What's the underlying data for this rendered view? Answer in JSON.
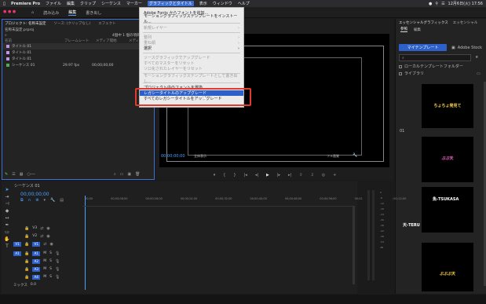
{
  "menubar": {
    "apple": "",
    "items": [
      "Premiere Pro",
      "ファイル",
      "編集",
      "クリップ",
      "シーケンス",
      "マーカー",
      "グラフィックとタイトル",
      "表示",
      "ウィンドウ",
      "ヘルプ"
    ],
    "selected_index": 6,
    "clock": "12月6日(火) 17:56"
  },
  "appbar": {
    "tabs": [
      "読み込み",
      "編集",
      "書き出し"
    ],
    "active_tab": "編集"
  },
  "project": {
    "tabs": [
      "プロジェクト: 名称未設定",
      "ソース: (クリップなし)",
      "エフェクト",
      "エフェクト"
    ],
    "file": "名称未設定.prproj",
    "info": "4個中 1 個の項目が選択",
    "columns": [
      "名前",
      "フレームレート",
      "メディア開始",
      "メディア終了"
    ],
    "rows": [
      {
        "name": "タイトル 01",
        "color": "#c792ea",
        "fps": "",
        "start": "",
        "end": ""
      },
      {
        "name": "タイトル 01",
        "color": "#c792ea",
        "fps": "",
        "start": "",
        "end": ""
      },
      {
        "name": "タイトル 01",
        "color": "#c792ea",
        "fps": "",
        "start": "",
        "end": ""
      },
      {
        "name": "シーケンス 01",
        "color": "#4caf50",
        "fps": "29.97 fps",
        "start": "00;00;00;00",
        "end": ""
      }
    ]
  },
  "menu": {
    "items": [
      {
        "label": "Adobe Fonts からフォントを追加...",
        "type": "item"
      },
      {
        "label": "モーショングラフィックステンプレートをインストール...",
        "type": "item"
      },
      {
        "type": "sep"
      },
      {
        "label": "新規レイヤー",
        "type": "disabled",
        "submenu": true
      },
      {
        "type": "sep"
      },
      {
        "label": "整列",
        "type": "disabled",
        "submenu": true
      },
      {
        "label": "重ね順",
        "type": "disabled",
        "submenu": true
      },
      {
        "label": "選択",
        "type": "item",
        "submenu": true
      },
      {
        "type": "sep"
      },
      {
        "label": "ソースグラフィックでアップグレード",
        "type": "disabled"
      },
      {
        "label": "すべてのマスターをリセット",
        "type": "disabled"
      },
      {
        "label": "ソロ化されたレイヤーをリセット",
        "type": "disabled"
      },
      {
        "type": "sep"
      },
      {
        "label": "モーショングラフィックステンプレートとして書き出し...",
        "type": "disabled"
      },
      {
        "type": "sep"
      },
      {
        "label": "プロジェクト内のフォントを置換...",
        "type": "item"
      },
      {
        "label": "レガシータイトルのアップグレード",
        "type": "highlight"
      },
      {
        "label": "すべてのレガシータイトルをアップグレード",
        "type": "item"
      }
    ]
  },
  "program": {
    "timecode": "00;00;00;00",
    "fit": "全体表示",
    "quality": "フル画質",
    "end_timecode": ""
  },
  "essential_graphics": {
    "tabs": [
      "エッセンシャルグラフィックス",
      "エッセンシャル"
    ],
    "subtabs": [
      "参照",
      "編集"
    ],
    "library_button": "マイテンプレート",
    "stock_button": "Adobe Stock",
    "search_placeholder": "",
    "checkboxes": [
      "ローカルテンプレートフォルダー",
      "ライブラリ"
    ],
    "thumbs": [
      {
        "text": "ちょちょ発見て",
        "color": "#ffd84d",
        "top": 0
      },
      {
        "text": "ぷぷ天",
        "color": "#ff6ad5",
        "top": 0
      },
      {
        "text": "魚-TSUKASA",
        "color": "#ffffff",
        "top": 0
      },
      {
        "text": "天-TERU",
        "color": "#ffffff",
        "top": 0
      },
      {
        "text": "ぷぷぷ天",
        "color": "#ffd84d",
        "top": 0
      }
    ],
    "thumb_labels": [
      "",
      "01",
      "",
      "",
      ""
    ]
  },
  "timeline": {
    "title": "シーケンス 01",
    "timecode": "00;00;00;00",
    "ruler": [
      "00;00",
      "00;00;08;00",
      "00;00;16;00",
      "00;00;24;00",
      "00;00;32;00",
      "00;00;40;00",
      "00;00;48;00",
      "00;00;56;00",
      "00;01;04;00",
      "00;01;12;00",
      "00;01;20;00",
      "00;01;28;00",
      "00;01;36;00",
      "00;01;44;00"
    ],
    "video_tracks": [
      "V3",
      "V2",
      "V1"
    ],
    "audio_tracks": [
      "A1",
      "A2",
      "A3",
      "A4",
      "A5",
      "A6"
    ],
    "mix": "ミックス"
  }
}
